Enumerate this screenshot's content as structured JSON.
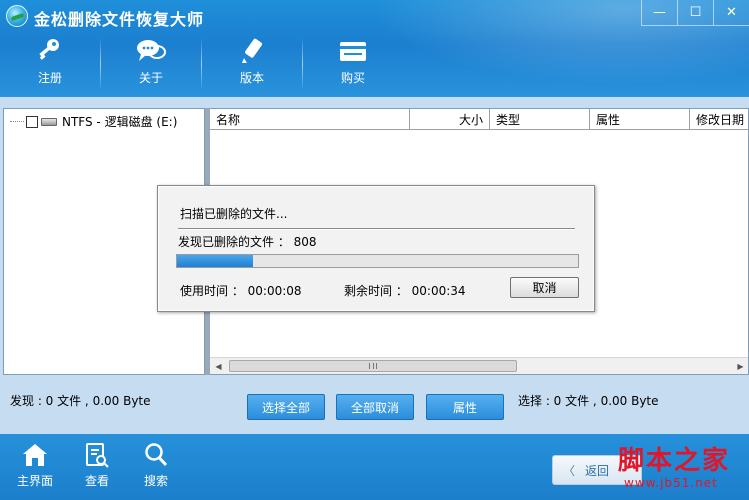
{
  "app": {
    "title": "金松删除文件恢复大师"
  },
  "window_controls": {
    "minimize": "—",
    "maximize": "☐",
    "close": "✕"
  },
  "toolbar": {
    "register": "注册",
    "about": "关于",
    "version": "版本",
    "buy": "购买"
  },
  "tree": {
    "drive_label": "NTFS - 逻辑磁盘 (E:)"
  },
  "list": {
    "columns": [
      "名称",
      "大小",
      "类型",
      "属性",
      "修改日期"
    ]
  },
  "status": {
    "found": "发现 : 0 文件 , 0.00 Byte",
    "selected": "选择 : 0 文件 , 0.00 Byte",
    "select_all": "选择全部",
    "cancel_all": "全部取消",
    "properties": "属性"
  },
  "dialog": {
    "title": "扫描已删除的文件...",
    "found": "发现已删除的文件 ： 808",
    "progress_fraction": 0.19,
    "elapsed": "使用时间 ： 00:00:08",
    "remaining": "剩余时间 ： 00:00:34",
    "cancel": "取消"
  },
  "bottom": {
    "home": "主界面",
    "view": "查看",
    "search": "搜索",
    "back": "返回"
  },
  "watermark": {
    "text": "脚本之家",
    "url": "www.jb51.net"
  },
  "colors": {
    "accent": "#1b7fd0",
    "progress": "#1f7fd4",
    "panel_bg": "#c6dcf1",
    "watermark": "#e0162b"
  }
}
